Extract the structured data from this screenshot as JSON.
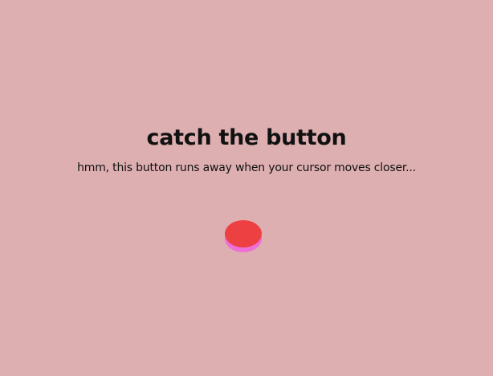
{
  "page": {
    "title": "catch the button",
    "subtitle": "hmm, this button runs away when your cursor moves closer..."
  },
  "colors": {
    "background": "#deafb0",
    "text": "#111111",
    "button_face": "#ec4043",
    "button_base": "#ee6fd6"
  }
}
